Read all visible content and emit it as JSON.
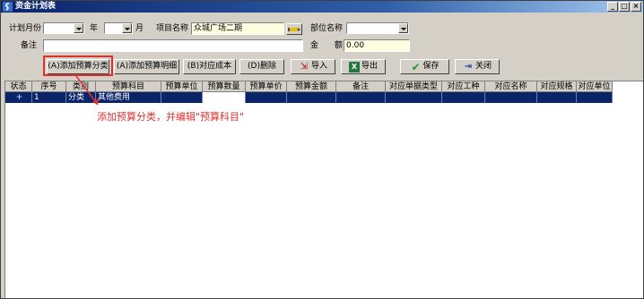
{
  "window": {
    "title": "资金计划表",
    "controls": [
      "_",
      "□",
      "×"
    ]
  },
  "form": {
    "plan_month_label": "计划月份",
    "year_label": "年",
    "month_label": "月",
    "year_value": "",
    "month_value": "",
    "project_label": "项目名称",
    "project_value": "众城广场二期",
    "dept_label": "部位名称",
    "dept_value": "",
    "remark_label": "备注",
    "remark_value": "",
    "amount_label": "金　　额",
    "amount_value": "0.00"
  },
  "toolbar": {
    "add_category": "(A)添加预算分类",
    "add_detail": "(A)添加预算明细",
    "match_cost": "(B)对应成本",
    "delete": "(D)删除",
    "import": "导入",
    "export": "导出",
    "save": "保存",
    "close": "关闭"
  },
  "table": {
    "columns": [
      "状态",
      "序号",
      "类别",
      "预算科目",
      "预算单位",
      "预算数量",
      "预算单价",
      "预算金额",
      "备注",
      "对应单据类型",
      "对应工种",
      "对应名称",
      "对应规格",
      "对应单位"
    ],
    "rows": [
      {
        "status": "+",
        "seq": "1",
        "type": "分类",
        "subject": "其他费用",
        "unit": "",
        "qty": "",
        "price": "",
        "amount": "",
        "remark": "",
        "doc_type": "",
        "trade": "",
        "name": "",
        "spec": "",
        "match_unit": ""
      }
    ]
  },
  "annotation": "添加预算分类，并编辑\"预算科目\"",
  "colors": {
    "title_bar": "#0a246a",
    "selected_row": "#0a246a",
    "annotation": "#e03030",
    "window_face": "#d4d0c8"
  }
}
